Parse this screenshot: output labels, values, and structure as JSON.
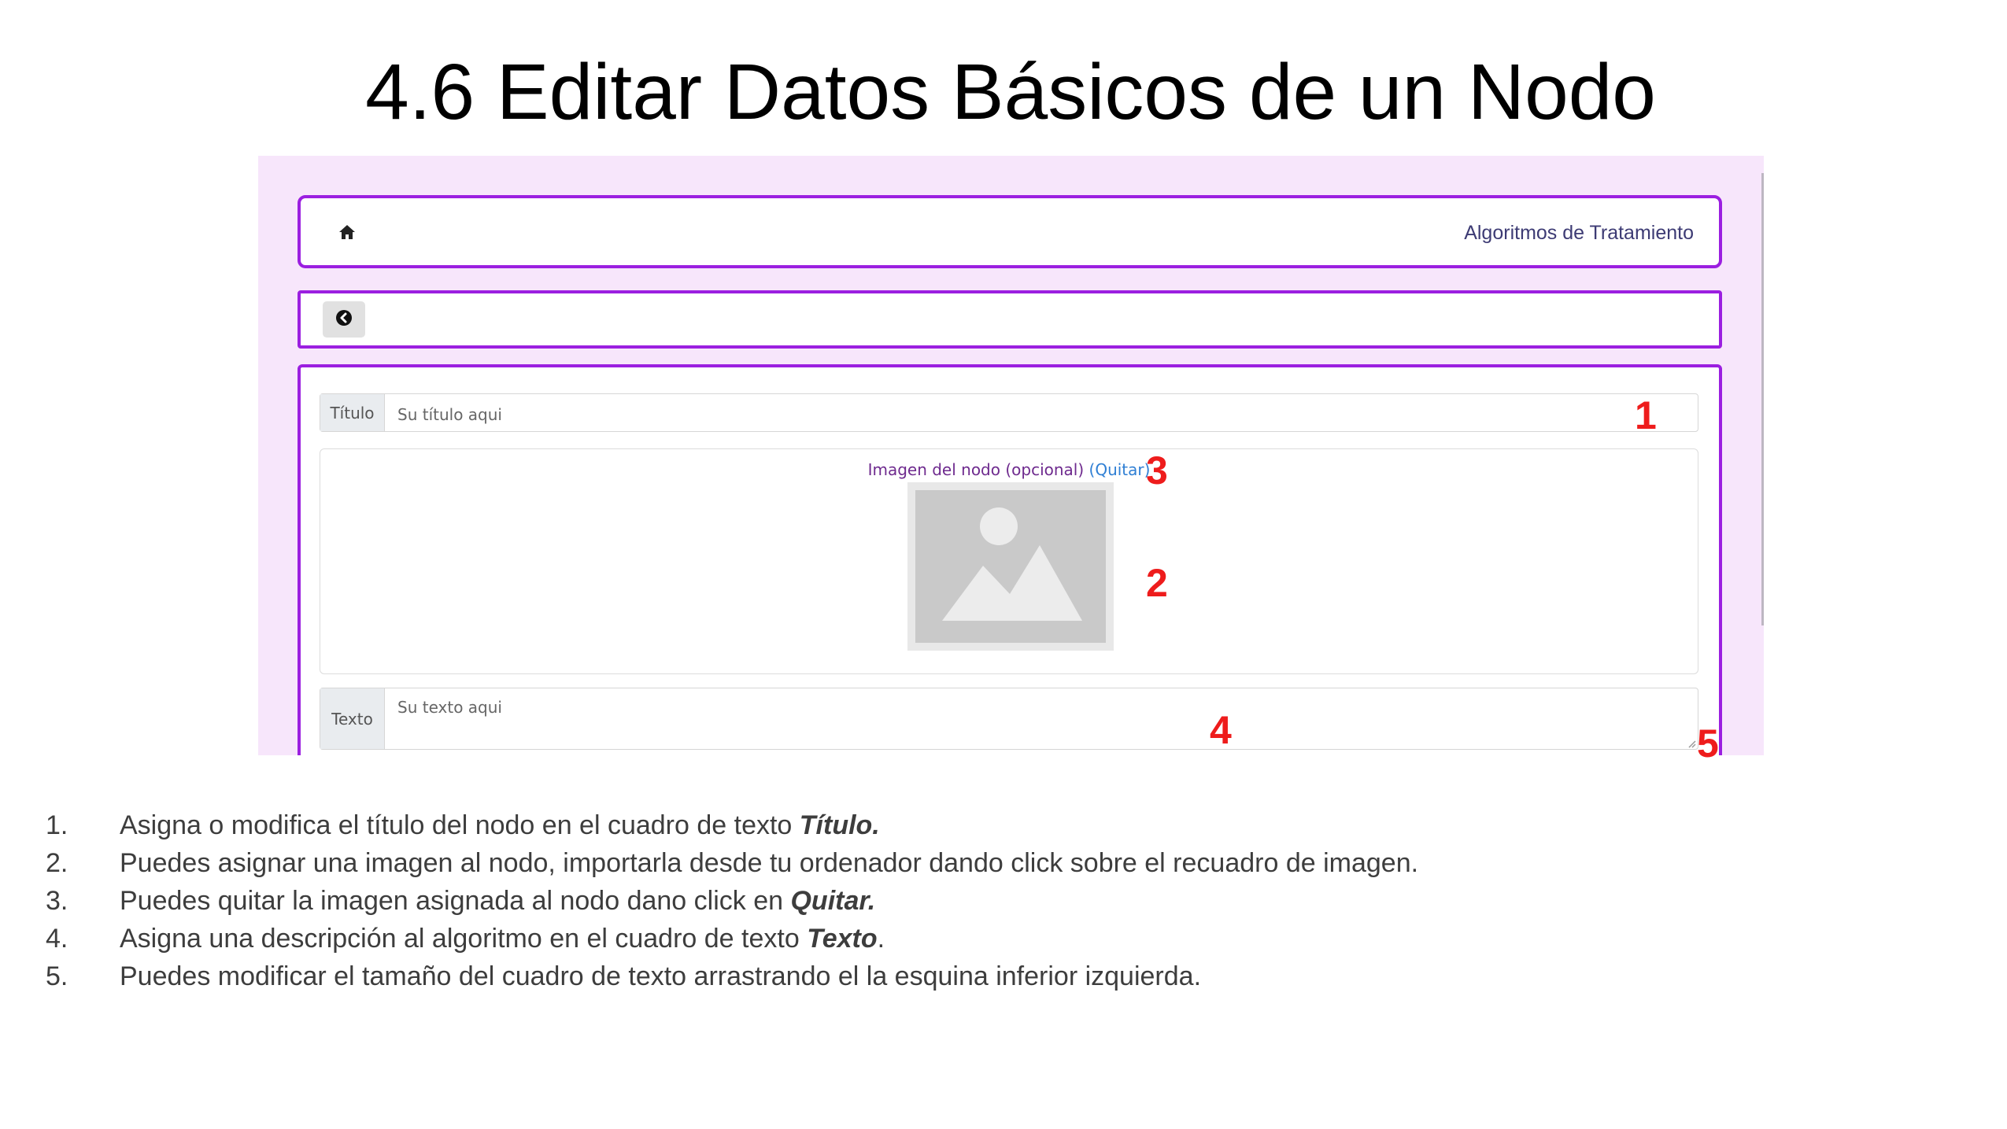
{
  "slide": {
    "title": "4.6 Editar Datos Básicos de un Nodo"
  },
  "app": {
    "brand": "Algoritmos de Tratamiento",
    "icons": [
      "home-icon",
      "back-circle-icon",
      "image-placeholder-icon",
      "resize-grip-icon"
    ],
    "colors": {
      "panel_border": "#9b1fe0",
      "page_background": "#f7e6fb",
      "annotation": "#ee1c1c",
      "link": "#2f7fd4"
    }
  },
  "form": {
    "title_label": "Título",
    "title_placeholder": "Su título aqui",
    "image_label": "Imagen del nodo (opcional)",
    "remove_link": "(Quitar)",
    "text_label": "Texto",
    "text_placeholder": "Su texto aqui"
  },
  "annotations": [
    "1",
    "2",
    "3",
    "4",
    "5"
  ],
  "instructions": [
    {
      "num": "1.",
      "before": "Asigna o modifica el título del nodo en el cuadro de texto ",
      "emph": "Título.",
      "after": ""
    },
    {
      "num": "2.",
      "before": "Puedes asignar una imagen al nodo, importarla desde tu ordenador dando click sobre el recuadro de imagen.",
      "emph": "",
      "after": ""
    },
    {
      "num": "3.",
      "before": "Puedes quitar la imagen asignada al nodo dano click en ",
      "emph": "Quitar.",
      "after": ""
    },
    {
      "num": "4.",
      "before": "Asigna una descripción al algoritmo en el cuadro de texto ",
      "emph": "Texto",
      "after": "."
    },
    {
      "num": "5.",
      "before": "Puedes modificar el tamaño del cuadro de texto arrastrando el la esquina inferior izquierda.",
      "emph": "",
      "after": ""
    }
  ]
}
